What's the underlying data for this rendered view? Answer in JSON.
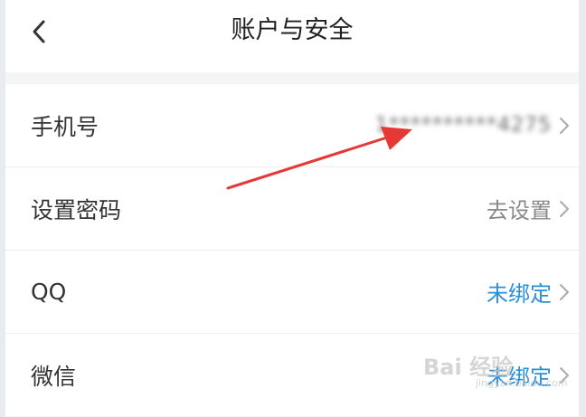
{
  "header": {
    "title": "账户与安全",
    "back_icon": "chevron-left-icon"
  },
  "rows": [
    {
      "label": "手机号",
      "value": "1**********4275",
      "value_state": "masked"
    },
    {
      "label": "设置密码",
      "value": "去设置"
    },
    {
      "label": "QQ",
      "value": "未绑定"
    },
    {
      "label": "微信",
      "value": "未绑定"
    }
  ],
  "watermark": {
    "main": "Bai 经验",
    "sub": "jingyan.baidu.com"
  },
  "colors": {
    "link": "#2b8fd8",
    "annotation_arrow": "#e53935",
    "background": "#f4f5f6"
  }
}
